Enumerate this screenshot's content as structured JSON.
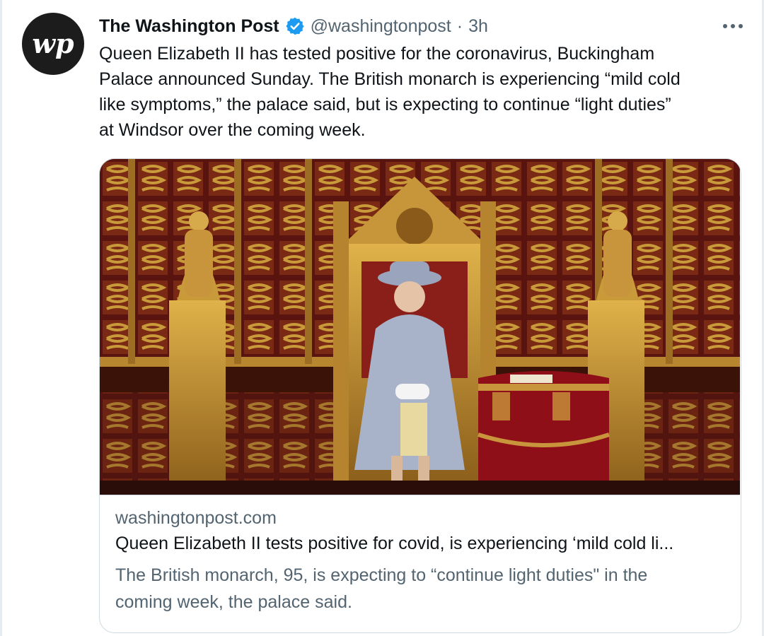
{
  "account": {
    "display_name": "The Washington Post",
    "handle": "@washingtonpost",
    "separator": "·",
    "timestamp": "3h",
    "avatar_icon": "wp-logo-icon",
    "verified_icon": "verified-badge-icon",
    "verified_color": "#1d9bf0"
  },
  "tweet": {
    "text_lines": [
      "Queen Elizabeth II has tested positive for the coronavirus, Buckingham",
      "Palace announced Sunday. The British monarch is experiencing “mild cold",
      "like symptoms,” the palace said, but is expecting to continue “light duties”",
      "at Windsor over the coming week."
    ]
  },
  "card": {
    "domain": "washingtonpost.com",
    "title": "Queen Elizabeth II tests positive for covid, is experiencing ‘mild cold li...",
    "description_lines": [
      "The British monarch, 95, is expecting to “continue light duties\" in the",
      "coming week, the palace said."
    ]
  },
  "more_icon": "more-horizontal-icon"
}
